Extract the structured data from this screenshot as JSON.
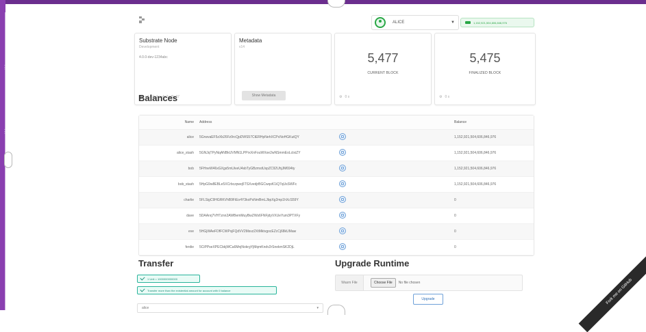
{
  "header": {
    "account_name": "ALICE",
    "balance_pill": "1,152,921,504,606,846,976"
  },
  "cards": {
    "node": {
      "title": "Substrate Node",
      "subtitle": "Development",
      "version": "4.0.0-dev-1234abc",
      "footer": "v4.0.0-dev-4a2ad9e07"
    },
    "metadata": {
      "title": "Metadata",
      "subtitle": "v14",
      "button": "Show Metadata"
    },
    "current_block": {
      "value": "5,477",
      "label": "CURRENT BLOCK",
      "footer": "0 s"
    },
    "finalized_block": {
      "value": "5,475",
      "label": "FINALIZED BLOCK",
      "footer": "0 s"
    }
  },
  "balances": {
    "title": "Balances",
    "columns": {
      "name": "Name",
      "address": "Address",
      "balance": "Balance"
    },
    "rows": [
      {
        "name": "alice",
        "address": "5GrwvaEF5zXb26Fz9rcQpDWS57CtERHpNehXCPcNoHGKutQY",
        "balance": "1,152,921,504,606,846,976"
      },
      {
        "name": "alice_stash",
        "address": "5GNJqTPyNqANBkUVMN1LPPrxXnFouWXoe2wNSmmEoLctxiZY",
        "balance": "1,152,921,504,606,846,976"
      },
      {
        "name": "bob",
        "address": "5FHneW46xGXgs5mUiveU4sbTyGBzmstUspZC92UhjJM694ty",
        "balance": "1,152,921,504,606,846,976"
      },
      {
        "name": "bob_stash",
        "address": "5HpG9w8EBLe5XCrbczpwq5TSXvedjrBGCwqxK1iQ7qUsSWFc",
        "balance": "1,152,921,504,606,846,976"
      },
      {
        "name": "charlie",
        "address": "5FLSigC9HGRKVhB9FiEo4Y3koPsNmBmLJbpXg2mp1hXcS59Y",
        "balance": "0"
      },
      {
        "name": "dave",
        "address": "5DAAnrj7VHTznn2AWBemMuyBwZWs6FNFjdyVXUeYum3PTXFy",
        "balance": "0"
      },
      {
        "name": "eve",
        "address": "5HGjWAeFDfFCWPsjFQdVV2Msvz2XtMktvgocEZcCj68kUMaw",
        "balance": "0"
      },
      {
        "name": "ferdie",
        "address": "5CiPPseXPECbkjWCa6MnjNokrgYjMqmKndv2rSnekmSK2DjL",
        "balance": "0"
      }
    ]
  },
  "transfer": {
    "title": "Transfer",
    "tag1": "1 Unit = 1000000000000",
    "tag2": "Transfer more than the existential amount for account with 0 balance",
    "from_value": "alice"
  },
  "upgrade": {
    "title": "Upgrade Runtime",
    "file_label": "Wasm File",
    "choose_file": "Choose File",
    "no_file": "No file chosen",
    "button": "Upgrade"
  },
  "ribbon": "Fork me on GitHub"
}
